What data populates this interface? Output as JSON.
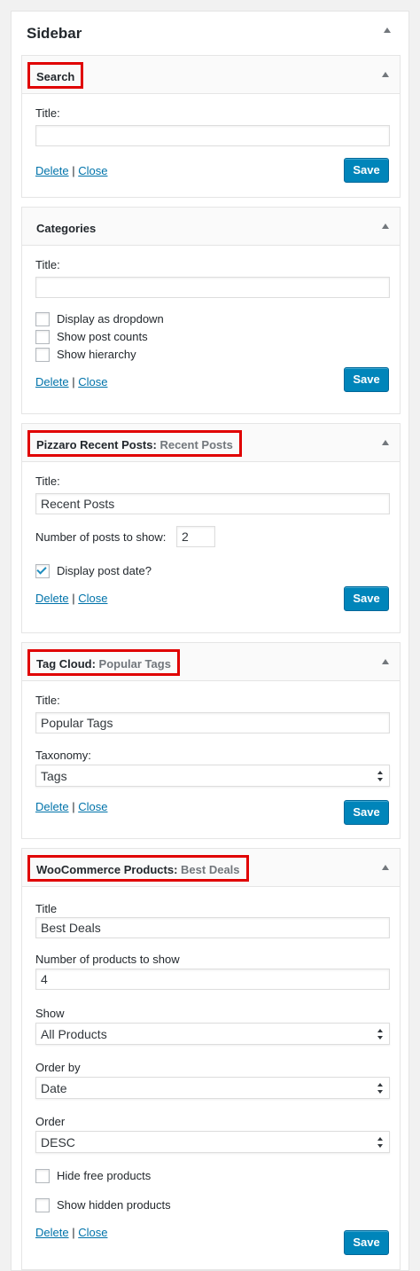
{
  "sidebar": {
    "title": "Sidebar"
  },
  "common": {
    "delete_label": "Delete",
    "separator": "|",
    "close_label": "Close",
    "save_label": "Save"
  },
  "search": {
    "name": "Search",
    "title_label": "Title:",
    "title_value": ""
  },
  "categories": {
    "name": "Categories",
    "title_label": "Title:",
    "title_value": "",
    "options": [
      {
        "label": "Display as dropdown",
        "checked": false
      },
      {
        "label": "Show post counts",
        "checked": false
      },
      {
        "label": "Show hierarchy",
        "checked": false
      }
    ]
  },
  "recent_posts": {
    "name": "Pizzaro Recent Posts:",
    "subtitle": "Recent Posts",
    "title_label": "Title:",
    "title_value": "Recent Posts",
    "number_label": "Number of posts to show:",
    "number_value": "2",
    "display_date_label": "Display post date?",
    "display_date_checked": true
  },
  "tag_cloud": {
    "name": "Tag Cloud:",
    "subtitle": "Popular Tags",
    "title_label": "Title:",
    "title_value": "Popular Tags",
    "taxonomy_label": "Taxonomy:",
    "taxonomy_value": "Tags"
  },
  "woo_products": {
    "name": "WooCommerce Products:",
    "subtitle": "Best Deals",
    "title_label": "Title",
    "title_value": "Best Deals",
    "number_label": "Number of products to show",
    "number_value": "4",
    "show_label": "Show",
    "show_value": "All Products",
    "orderby_label": "Order by",
    "orderby_value": "Date",
    "order_label": "Order",
    "order_value": "DESC",
    "hide_free_label": "Hide free products",
    "hide_free_checked": false,
    "show_hidden_label": "Show hidden products",
    "show_hidden_checked": false
  },
  "colors": {
    "highlight": "#e00000",
    "primary_button": "#0085ba",
    "link": "#0073aa",
    "check": "#1e8cbe"
  }
}
